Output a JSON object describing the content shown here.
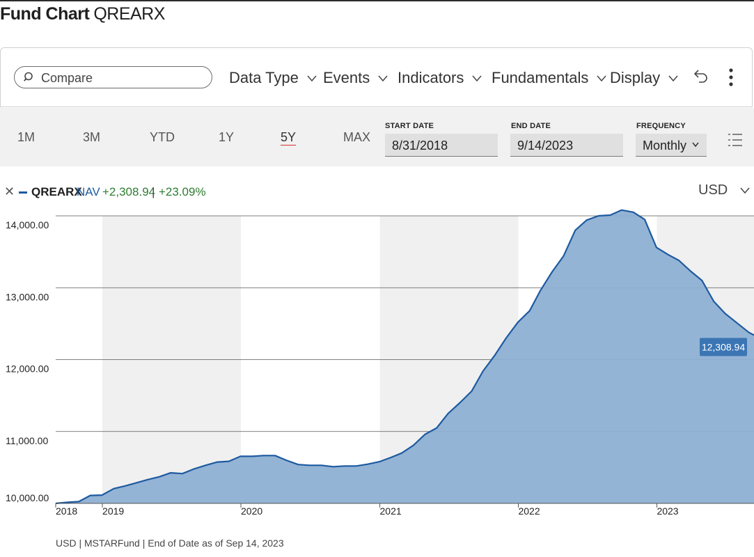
{
  "header": {
    "title_strong": "Fund Chart",
    "ticker": "QREARX"
  },
  "toolbar": {
    "search_placeholder": "Compare",
    "menus": [
      "Data Type",
      "Events",
      "Indicators",
      "Fundamentals",
      "Display"
    ]
  },
  "range": {
    "options": [
      "1M",
      "3M",
      "YTD",
      "1Y",
      "5Y",
      "MAX"
    ],
    "active": "5Y",
    "start_label": "START DATE",
    "start_value": "8/31/2018",
    "end_label": "END DATE",
    "end_value": "9/14/2023",
    "frequency_label": "FREQUENCY",
    "frequency_value": "Monthly"
  },
  "legend": {
    "symbol": "QREARX",
    "measure": "NAV",
    "change": "+2,308.94",
    "separator": "|",
    "change_pct": "+23.09%",
    "currency": "USD"
  },
  "colors": {
    "series": "#1d5aa0",
    "fill": "#8eb0d3",
    "positive": "#2e7d32",
    "accent": "#d72f2f"
  },
  "chart_data": {
    "type": "area",
    "series_name": "QREARX",
    "x_tick_labels": [
      "2018",
      "2019",
      "2020",
      "2021",
      "2022",
      "2023"
    ],
    "y_tick_labels": [
      "10,000.00",
      "11,000.00",
      "12,000.00",
      "13,000.00",
      "14,000.00"
    ],
    "ylim": [
      10000,
      14000
    ],
    "xlim": [
      "2018-08-31",
      "2023-09-14"
    ],
    "last_value_label": "12,308.94",
    "points": [
      [
        "2018-08-31",
        10000
      ],
      [
        "2018-09-30",
        10015
      ],
      [
        "2018-10-31",
        10025
      ],
      [
        "2018-11-30",
        10110
      ],
      [
        "2018-12-31",
        10115
      ],
      [
        "2019-01-31",
        10205
      ],
      [
        "2019-02-28",
        10240
      ],
      [
        "2019-03-31",
        10285
      ],
      [
        "2019-04-30",
        10330
      ],
      [
        "2019-05-31",
        10370
      ],
      [
        "2019-06-30",
        10425
      ],
      [
        "2019-07-31",
        10415
      ],
      [
        "2019-08-31",
        10480
      ],
      [
        "2019-09-30",
        10530
      ],
      [
        "2019-10-31",
        10575
      ],
      [
        "2019-11-30",
        10585
      ],
      [
        "2019-12-31",
        10655
      ],
      [
        "2020-01-31",
        10655
      ],
      [
        "2020-02-29",
        10665
      ],
      [
        "2020-03-31",
        10665
      ],
      [
        "2020-04-30",
        10600
      ],
      [
        "2020-05-31",
        10540
      ],
      [
        "2020-06-30",
        10530
      ],
      [
        "2020-07-31",
        10530
      ],
      [
        "2020-08-31",
        10510
      ],
      [
        "2020-09-30",
        10520
      ],
      [
        "2020-10-31",
        10520
      ],
      [
        "2020-11-30",
        10545
      ],
      [
        "2020-12-31",
        10580
      ],
      [
        "2021-01-31",
        10640
      ],
      [
        "2021-02-28",
        10700
      ],
      [
        "2021-03-31",
        10810
      ],
      [
        "2021-04-30",
        10960
      ],
      [
        "2021-05-31",
        11050
      ],
      [
        "2021-06-30",
        11250
      ],
      [
        "2021-07-31",
        11400
      ],
      [
        "2021-08-31",
        11560
      ],
      [
        "2021-09-30",
        11840
      ],
      [
        "2021-10-31",
        12060
      ],
      [
        "2021-11-30",
        12300
      ],
      [
        "2021-12-31",
        12520
      ],
      [
        "2022-01-31",
        12680
      ],
      [
        "2022-02-28",
        12960
      ],
      [
        "2022-03-31",
        13220
      ],
      [
        "2022-04-30",
        13440
      ],
      [
        "2022-05-31",
        13800
      ],
      [
        "2022-06-30",
        13940
      ],
      [
        "2022-07-31",
        14000
      ],
      [
        "2022-08-31",
        14010
      ],
      [
        "2022-09-30",
        14080
      ],
      [
        "2022-10-31",
        14050
      ],
      [
        "2022-11-30",
        13950
      ],
      [
        "2022-12-31",
        13560
      ],
      [
        "2023-01-31",
        13460
      ],
      [
        "2023-02-28",
        13380
      ],
      [
        "2023-03-31",
        13230
      ],
      [
        "2023-04-30",
        13100
      ],
      [
        "2023-05-31",
        12810
      ],
      [
        "2023-06-30",
        12640
      ],
      [
        "2023-07-31",
        12510
      ],
      [
        "2023-08-31",
        12380
      ],
      [
        "2023-09-14",
        12340
      ]
    ],
    "grid": true
  },
  "footer": {
    "text": "USD | MSTARFund | End of Date as of Sep 14, 2023"
  }
}
